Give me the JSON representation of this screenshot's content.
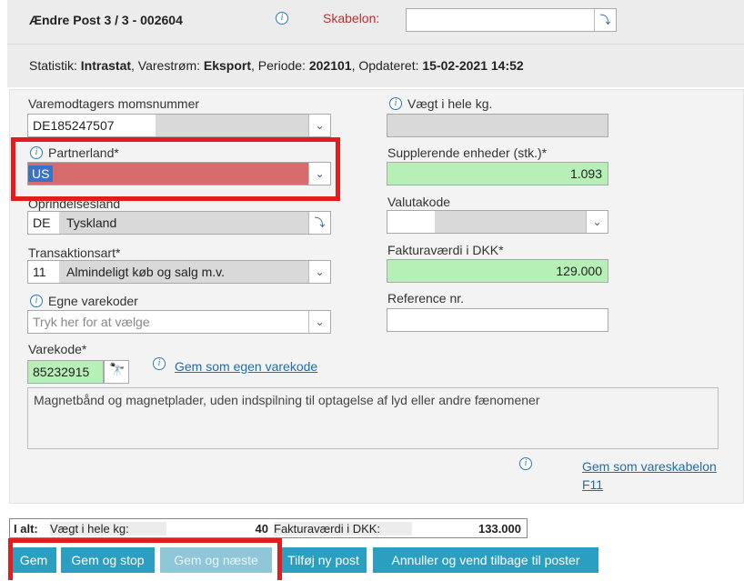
{
  "header": {
    "title": "Ændre Post 3 / 3 - 002604",
    "template_label": "Skabelon:",
    "template_value": ""
  },
  "stats": {
    "prefix": "Statistik:",
    "statistik": "Intrastat",
    "varestrom_label": ", Varestrøm:",
    "varestrom": "Eksport",
    "periode_label": ", Periode:",
    "periode": "202101",
    "opdateret_label": ", Opdateret:",
    "opdateret": "15-02-2021 14:52"
  },
  "left": {
    "vat_label": "Varemodtagers momsnummer",
    "vat_value": "DE185247507",
    "partner_label": "Partnerland*",
    "partner_code": "US",
    "origin_label": "Oprindelsesland",
    "origin_code": "DE",
    "origin_name": "Tyskland",
    "trans_label": "Transaktionsart*",
    "trans_code": "11",
    "trans_name": "Almindeligt køb og salg m.v.",
    "own_codes_label": "Egne varekoder",
    "own_codes_placeholder": "Tryk her for at vælge",
    "varekode_label": "Varekode*",
    "varekode_value": "85232915",
    "save_own_code_link": "Gem som egen varekode"
  },
  "right": {
    "weight_label": "Vægt i hele kg.",
    "weight_value": "",
    "supp_label": "Supplerende enheder (stk.)*",
    "supp_value": "1.093",
    "currency_label": "Valutakode",
    "currency_value": "",
    "invoice_label": "Fakturaværdi i DKK*",
    "invoice_value": "129.000",
    "ref_label": "Reference nr.",
    "ref_value": ""
  },
  "description": "Magnetbånd og magnetplader, uden indspilning til optagelse af lyd eller andre fænomener",
  "template_link_line1": "Gem som vareskabelon",
  "template_link_line2": "F11",
  "totals": {
    "label": "I alt:",
    "weight_label": "Vægt i hele kg:",
    "weight_value": "40",
    "invoice_label": "Fakturaværdi i DKK:",
    "invoice_value": "133.000"
  },
  "buttons": {
    "gem": "Gem",
    "gem_stop": "Gem og stop",
    "gem_next": "Gem og næste",
    "add_post": "Tilføj ny post",
    "cancel": "Annuller og vend tilbage til poster"
  },
  "icons": {
    "info": "i",
    "dropdown": "chevron-double-down-icon",
    "popup": "popup-arrow-icon",
    "binoculars": "binoculars-icon"
  },
  "colors": {
    "accent": "#2a9fc2",
    "highlight": "#e31d1d",
    "valid": "#b7f0b7",
    "selected_error": "#d86b6b"
  }
}
